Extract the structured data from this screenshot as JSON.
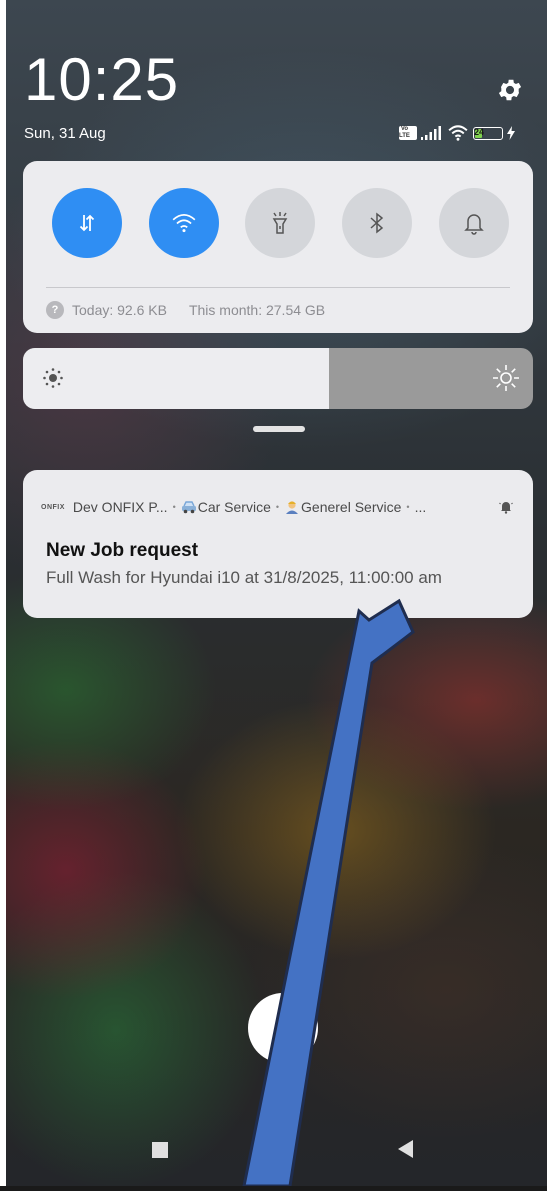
{
  "status_bar": {
    "time": "10:25",
    "date": "Sun, 31 Aug",
    "battery_level": "24",
    "volte_line1": "Vo",
    "volte_line2": "LTE"
  },
  "quick_settings": {
    "toggles": [
      {
        "name": "mobile-data",
        "icon": "data-arrows-icon",
        "active": true
      },
      {
        "name": "wifi",
        "icon": "wifi-icon",
        "active": true
      },
      {
        "name": "flashlight",
        "icon": "flashlight-icon",
        "active": false
      },
      {
        "name": "bluetooth",
        "icon": "bluetooth-icon",
        "active": false
      },
      {
        "name": "sound",
        "icon": "bell-icon",
        "active": false
      }
    ],
    "data_today": "Today: 92.6 KB",
    "data_month": "This month: 27.54 GB",
    "help_glyph": "?"
  },
  "brightness": {
    "level_percent": 60
  },
  "notification": {
    "app_logo": "ONFIX",
    "app_name": "Dev ONFIX P...",
    "channel": "Car Service",
    "category": "Generel Service",
    "ellipsis": "...",
    "title": "New Job request",
    "body": "Full Wash for Hyundai i10 at 31/8/2025, 11:00:00 am"
  },
  "close_glyph": "✕",
  "colors": {
    "accent": "#2f8ef3",
    "panel": "#ececef",
    "arrow_fill": "#4472c4",
    "arrow_stroke": "#1f2d4f",
    "battery_fill": "#7fd24e"
  }
}
